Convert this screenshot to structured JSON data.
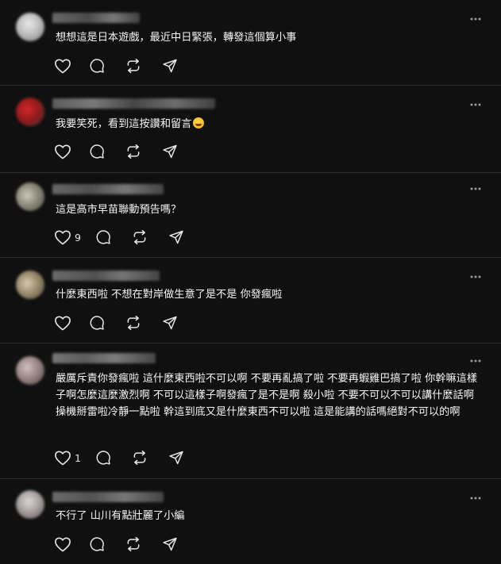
{
  "posts": [
    {
      "text": "想想這是日本遊戲，最近中日緊張，轉發這個算小事",
      "likes": ""
    },
    {
      "text": "我要笑死，看到這按讚和留言",
      "likes": ""
    },
    {
      "text": "這是高市早苗聯動預告嗎？",
      "likes": "9"
    },
    {
      "text": "什麼東西啦 不想在對岸做生意了是不是 你發瘋啦",
      "likes": ""
    },
    {
      "text": "嚴厲斥責你發瘋啦 這什麼東西啦不可以啊 不要再亂搞了啦 不要再蝦雞巴搞了啦 你幹嘛這樣 子啊怎麼這麼激烈啊 不可以這樣子啊發瘋了是不是啊 殺小啦 不要不可以不可以講什麼話啊 操機掰雷啦冷靜一點啦 幹這到底又是什麼東西不可以啦 這是能講的話嗎絕對不可以的啊",
      "likes": "1"
    },
    {
      "text": "不行了 山川有點壯麗了小編",
      "likes": ""
    }
  ],
  "icons": {
    "like": "heart-icon",
    "reply": "comment-icon",
    "repost": "repost-icon",
    "share": "share-icon",
    "more": "more-icon"
  },
  "colors": {
    "background": "#101010",
    "text": "#f3f5f7",
    "icon": "#e6e6e6",
    "divider": "#2e2e2e"
  }
}
